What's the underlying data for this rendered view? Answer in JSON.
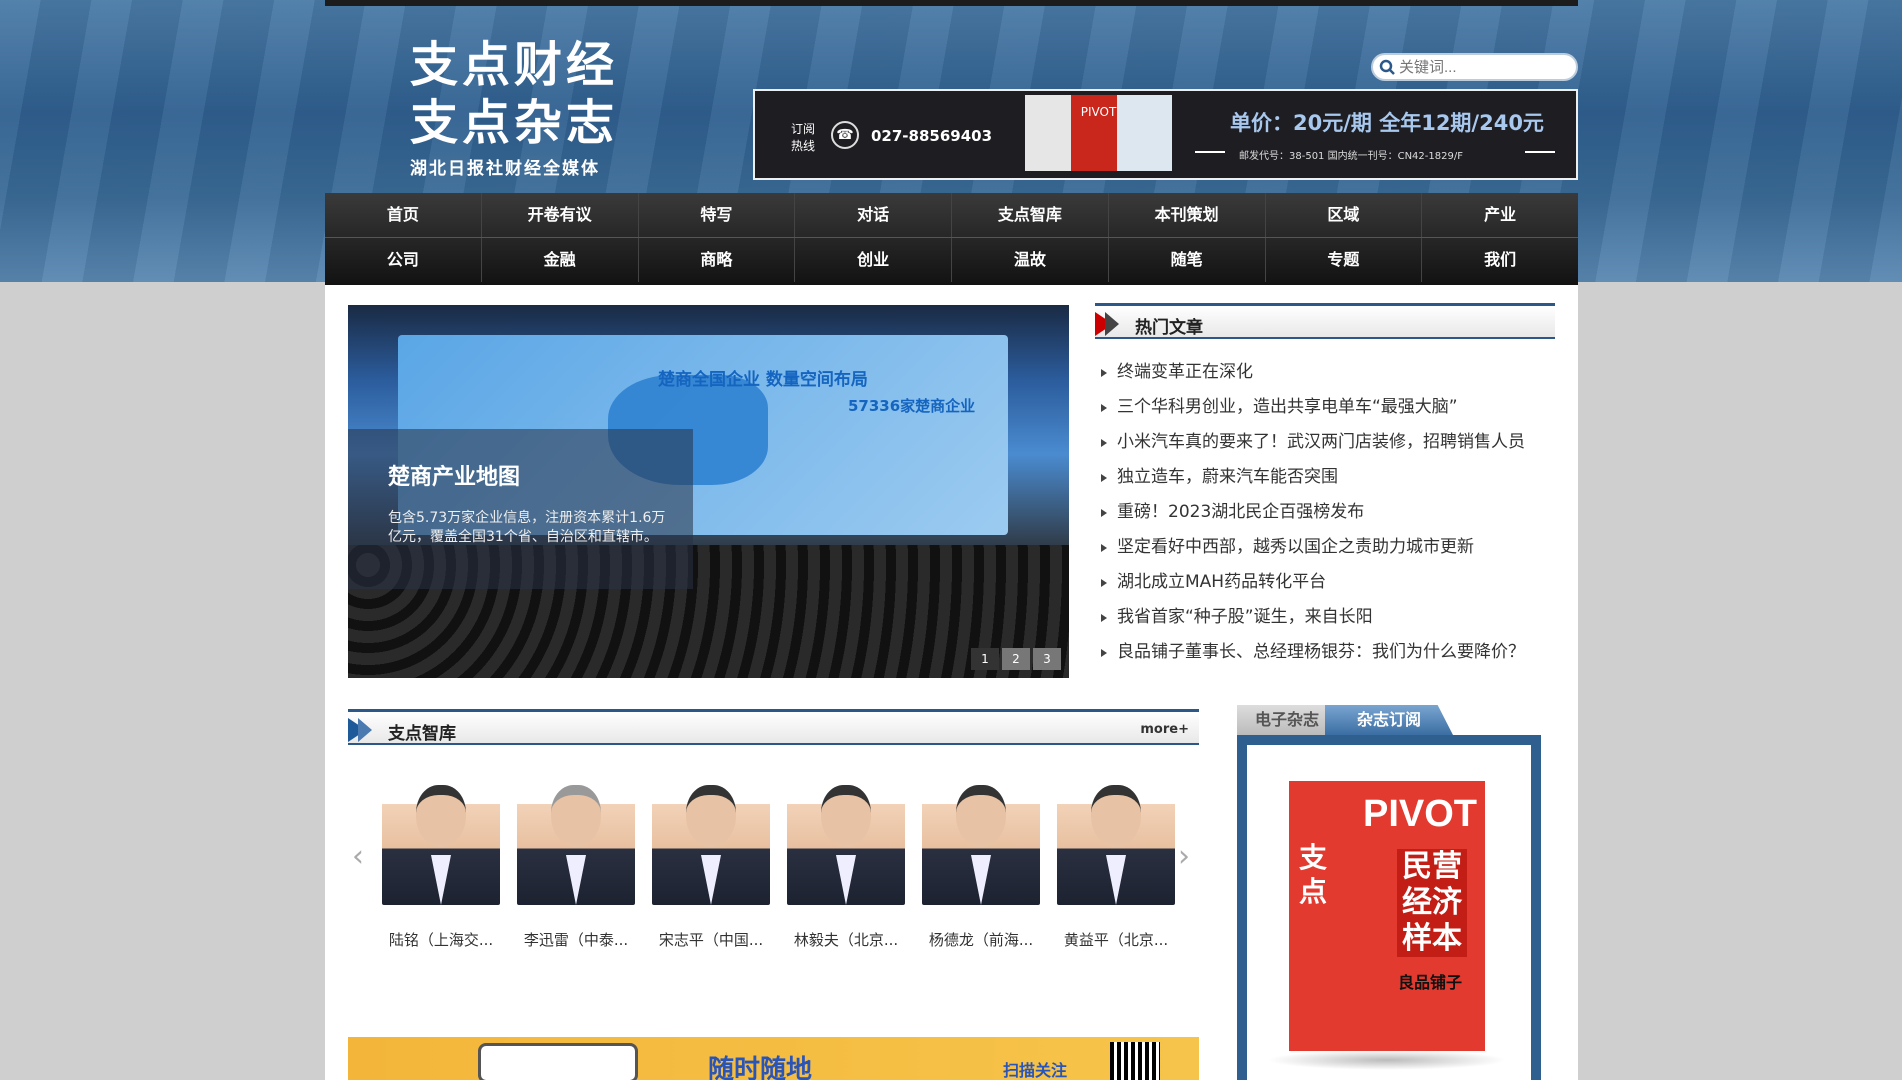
{
  "site": {
    "logo_line1": "支点财经",
    "logo_line2": "支点杂志",
    "logo_tagline": "湖北日报社财经全媒体"
  },
  "search": {
    "placeholder": "关键词..."
  },
  "banner": {
    "subscribe_label": "订阅热线",
    "phone": "027-88569403",
    "price": "单价：20元/期  全年12期/240元",
    "codes": "邮发代号：38-501   国内统一刊号：CN42-1829/F",
    "mag_badge": "PIVOT"
  },
  "nav": {
    "row1": [
      "首页",
      "开卷有议",
      "特写",
      "对话",
      "支点智库",
      "本刊策划",
      "区域",
      "产业"
    ],
    "row2": [
      "公司",
      "金融",
      "商略",
      "创业",
      "温故",
      "随笔",
      "专题",
      "我们"
    ]
  },
  "slider": {
    "screen_title": "楚商全国企业 数量空间布局",
    "screen_stat": "57336家楚商企业",
    "caption_title": "楚商产业地图",
    "caption_text": "包含5.73万家企业信息，注册资本累计1.6万亿元，覆盖全国31个省、自治区和直辖市。",
    "dots": [
      "1",
      "2",
      "3"
    ]
  },
  "hot": {
    "title": "热门文章",
    "items": [
      "终端变革正在深化",
      "三个华科男创业，造出共享电单车“最强大脑”",
      "小米汽车真的要来了！武汉两门店装修，招聘销售人员",
      "独立造车，蔚来汽车能否突围",
      "重磅！2023湖北民企百强榜发布",
      "坚定看好中西部，越秀以国企之责助力城市更新",
      "湖北成立MAH药品转化平台",
      "我省首家“种子股”诞生，来自长阳",
      "良品铺子董事长、总经理杨银芬：我们为什么要降价？"
    ]
  },
  "think": {
    "title": "支点智库",
    "more": "more+",
    "people": [
      "陆铭（上海交...",
      "李迅雷（中泰...",
      "宋志平（中国...",
      "林毅夫（北京...",
      "杨德龙（前海...",
      "黄益平（北京..."
    ]
  },
  "qrbar": {
    "text1": "随时随地",
    "text2": "扫描关注"
  },
  "emag": {
    "tab1": "电子杂志",
    "tab2": "杂志订阅",
    "cover_title": "PIVOT",
    "cover_cn": "支点",
    "cover_headline": "民营经济样本",
    "cover_sub": "良品铺子"
  }
}
